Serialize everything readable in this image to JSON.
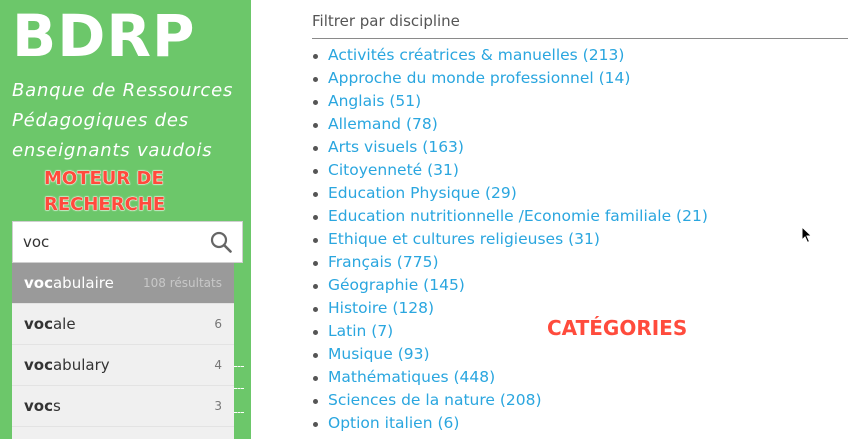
{
  "sidebar": {
    "logo": "BDRP",
    "tagline_lines": [
      "Banque de Ressources",
      "Pédagogiques des",
      "enseignants vaudois"
    ],
    "annotation_lines": [
      "MOTEUR DE",
      "RECHERCHE"
    ],
    "annotation_color": "#ff4b3c",
    "background_color": "#6cc76a"
  },
  "search": {
    "value": "voc",
    "icon": "search-icon"
  },
  "suggestions": [
    {
      "prefix": "voc",
      "rest": "abulaire",
      "count": "108 résultats"
    },
    {
      "prefix": "voc",
      "rest": "ale",
      "count": "6"
    },
    {
      "prefix": "voc",
      "rest": "abulary",
      "count": "4"
    },
    {
      "prefix": "voc",
      "rest": "s",
      "count": "3"
    }
  ],
  "main": {
    "filter_title": "Filtrer par discipline",
    "categories": [
      "Activités créatrices & manuelles (213)",
      "Approche du monde professionnel (14)",
      "Anglais (51)",
      "Allemand (78)",
      "Arts visuels (163)",
      "Citoyenneté (31)",
      "Education Physique (29)",
      "Education nutritionnelle /Economie familiale (21)",
      "Ethique et cultures religieuses (31)",
      "Français (775)",
      "Géographie (145)",
      "Histoire (128)",
      "Latin (7)",
      "Musique (93)",
      "Mathématiques (448)",
      "Sciences de la nature (208)",
      "Option italien (6)"
    ],
    "annotation": "CATÉGORIES",
    "link_color": "#2aa6df"
  }
}
